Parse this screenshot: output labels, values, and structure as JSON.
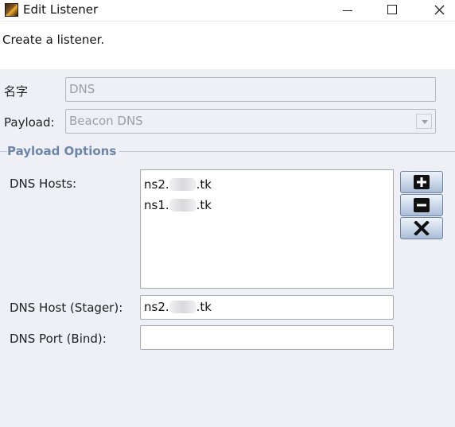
{
  "window": {
    "title": "Edit Listener",
    "icon": "app-logo-icon"
  },
  "header": {
    "text": "Create a listener."
  },
  "form": {
    "name": {
      "label": "名字",
      "value": "DNS"
    },
    "payload": {
      "label": "Payload:",
      "value": "Beacon DNS"
    }
  },
  "payload_options": {
    "title": "Payload Options",
    "dns_hosts": {
      "label": "DNS Hosts:",
      "items": [
        {
          "prefix": "ns2.",
          "suffix": ".tk"
        },
        {
          "prefix": "ns1.",
          "suffix": ".tk"
        }
      ],
      "buttons": [
        "plus-icon",
        "minus-icon",
        "x-icon"
      ]
    },
    "dns_host_stager": {
      "label": "DNS Host (Stager):",
      "prefix": "ns2.",
      "suffix": ".tk"
    },
    "dns_port_bind": {
      "label": "DNS Port (Bind):",
      "value": ""
    }
  },
  "colors": {
    "accent_title": "#6d85a8",
    "button_border": "#6f86a8",
    "icon_fill": "#111111"
  }
}
